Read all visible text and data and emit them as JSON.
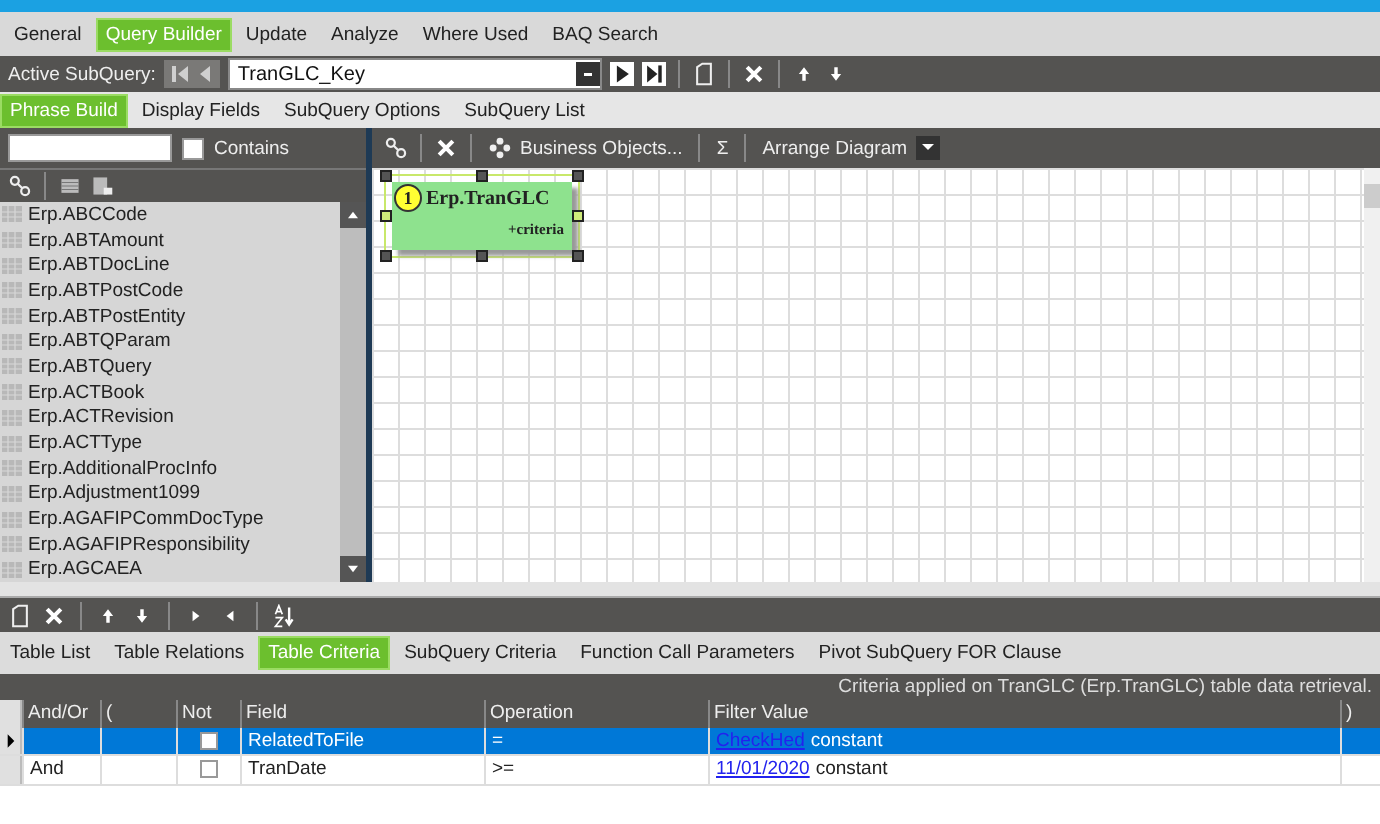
{
  "tabs": [
    {
      "label": "General",
      "selected": false
    },
    {
      "label": "Query Builder",
      "selected": true
    },
    {
      "label": "Update",
      "selected": false
    },
    {
      "label": "Analyze",
      "selected": false
    },
    {
      "label": "Where Used",
      "selected": false
    },
    {
      "label": "BAQ Search",
      "selected": false
    }
  ],
  "subquery_bar": {
    "label": "Active SubQuery:",
    "value": "TranGLC_Key"
  },
  "subtabs": [
    {
      "label": "Phrase Build",
      "selected": true
    },
    {
      "label": "Display Fields",
      "selected": false
    },
    {
      "label": "SubQuery Options",
      "selected": false
    },
    {
      "label": "SubQuery List",
      "selected": false
    }
  ],
  "table_filter": {
    "contains_label": "Contains",
    "contains_checked": false
  },
  "tables": [
    "Erp.ABCCode",
    "Erp.ABTAmount",
    "Erp.ABTDocLine",
    "Erp.ABTPostCode",
    "Erp.ABTPostEntity",
    "Erp.ABTQParam",
    "Erp.ABTQuery",
    "Erp.ACTBook",
    "Erp.ACTRevision",
    "Erp.ACTType",
    "Erp.AdditionalProcInfo",
    "Erp.Adjustment1099",
    "Erp.AGAFIPCommDocType",
    "Erp.AGAFIPResponsibility",
    "Erp.AGCAEA"
  ],
  "diagram_toolbar": {
    "business_objects": "Business Objects...",
    "sum": "Σ",
    "arrange": "Arrange Diagram"
  },
  "diagram": {
    "nodes": [
      {
        "badge": "1",
        "name": "Erp.TranGLC",
        "note": "+criteria",
        "selected": true
      }
    ]
  },
  "bottom_tabs": [
    {
      "label": "Table List",
      "selected": false
    },
    {
      "label": "Table Relations",
      "selected": false
    },
    {
      "label": "Table Criteria",
      "selected": true
    },
    {
      "label": "SubQuery Criteria",
      "selected": false
    },
    {
      "label": "Function Call Parameters",
      "selected": false
    },
    {
      "label": "Pivot SubQuery FOR Clause",
      "selected": false
    }
  ],
  "criteria": {
    "caption": "Criteria applied on TranGLC (Erp.TranGLC)  table data retrieval.",
    "columns": [
      "And/Or",
      "(",
      "Not",
      "Field",
      "Operation",
      "Filter Value",
      ")"
    ],
    "rows": [
      {
        "selected": true,
        "not": false,
        "field": "RelatedToFile",
        "operation": "=",
        "filter_link": "CheckHed",
        "filter_text": "constant"
      },
      {
        "selected": false,
        "and_or": "And",
        "not": false,
        "field": "TranDate",
        "operation": ">=",
        "filter_link": "11/01/2020",
        "filter_text": "constant"
      }
    ]
  }
}
